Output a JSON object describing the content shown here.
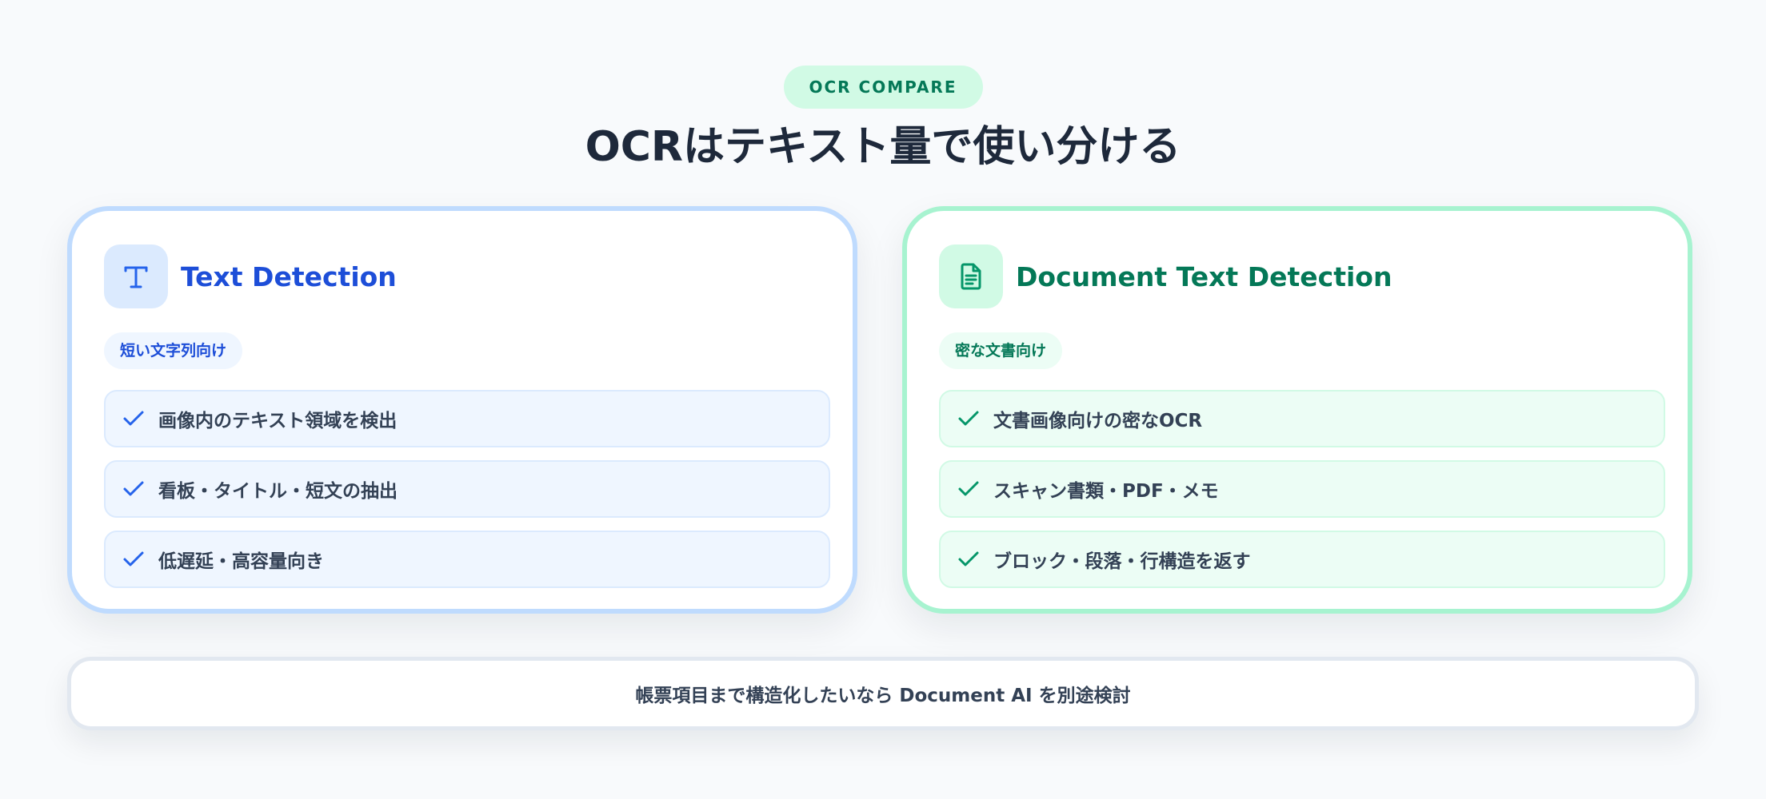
{
  "header": {
    "eyebrow": "OCR COMPARE",
    "title": "OCRはテキスト量で使い分ける"
  },
  "cards": [
    {
      "icon": "text-t-icon",
      "title": "Text Detection",
      "tag": "短い文字列向け",
      "accent": "#1d4ed8",
      "items": [
        "画像内のテキスト領域を検出",
        "看板・タイトル・短文の抽出",
        "低遅延・高容量向き"
      ]
    },
    {
      "icon": "document-icon",
      "title": "Document Text Detection",
      "tag": "密な文書向け",
      "accent": "#047857",
      "items": [
        "文書画像向けの密なOCR",
        "スキャン書類・PDF・メモ",
        "ブロック・段落・行構造を返す"
      ]
    }
  ],
  "footer": {
    "note": "帳票項目まで構造化したいなら Document AI を別途検討"
  }
}
